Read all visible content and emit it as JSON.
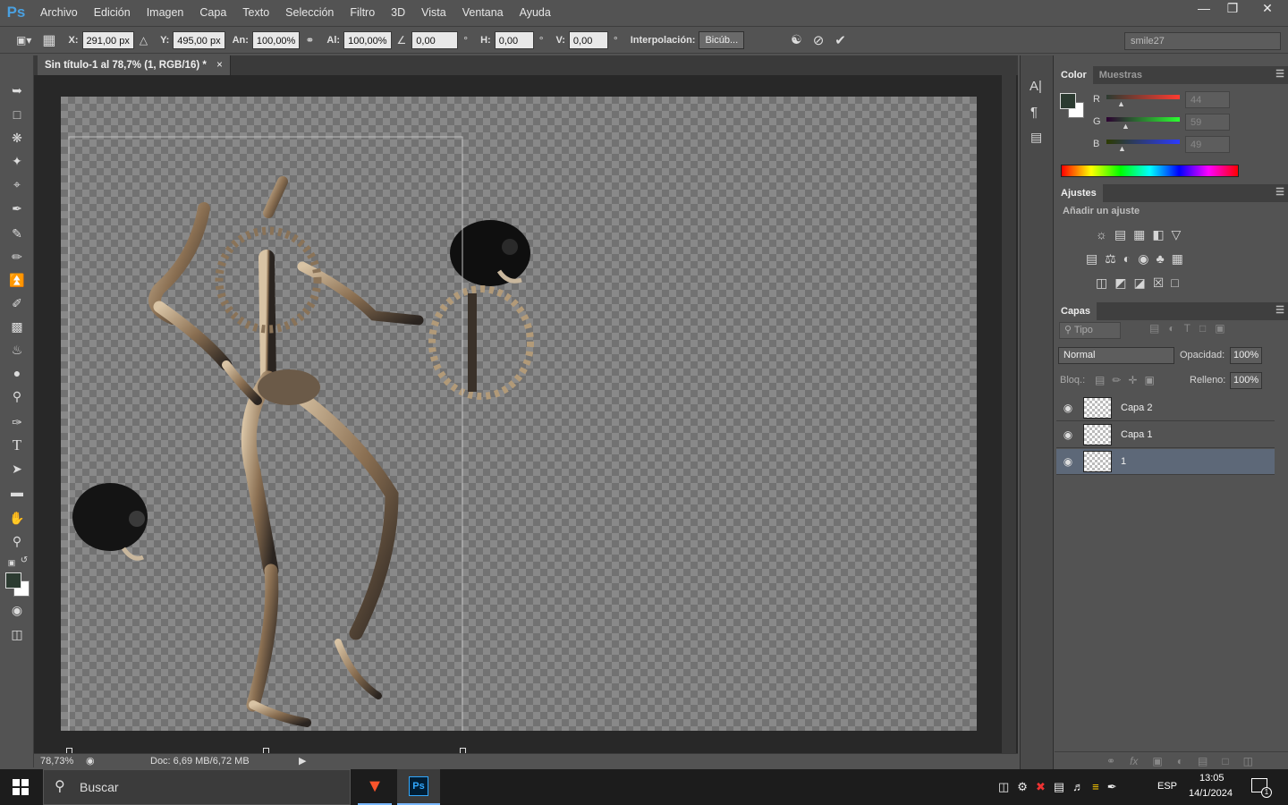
{
  "app": {
    "logo": "Ps"
  },
  "menu": [
    "Archivo",
    "Edición",
    "Imagen",
    "Capa",
    "Texto",
    "Selección",
    "Filtro",
    "3D",
    "Vista",
    "Ventana",
    "Ayuda"
  ],
  "window_controls": [
    "minimize-icon",
    "restore-icon",
    "close-icon"
  ],
  "options": {
    "x_label": "X:",
    "x_value": "291,00 px",
    "y_label": "Y:",
    "y_value": "495,00 px",
    "w_label": "An:",
    "w_value": "100,00%",
    "h_label": "Al:",
    "h_value": "100,00%",
    "angle_value": "0,00",
    "deg": "°",
    "hskew_label": "H:",
    "hskew_value": "0,00",
    "vskew_label": "V:",
    "vskew_value": "0,00",
    "interp_label": "Interpolación:",
    "interp_value": "Bicúb...",
    "workspace": "smile27"
  },
  "document": {
    "tab_title": "Sin título-1 al 78,7% (1, RGB/16) *",
    "tab_close": "×",
    "zoom": "78,73%",
    "doc_size": "Doc: 6,69 MB/6,72 MB"
  },
  "color_panel": {
    "tabs": [
      "Color",
      "Muestras"
    ],
    "channels": [
      {
        "label": "R",
        "value": "44",
        "fraction": 0.17
      },
      {
        "label": "G",
        "value": "59",
        "fraction": 0.23
      },
      {
        "label": "B",
        "value": "49",
        "fraction": 0.19
      }
    ],
    "foreground": "#2c3b31",
    "background": "#ffffff"
  },
  "adjustments": {
    "tab": "Ajustes",
    "subtitle": "Añadir un ajuste"
  },
  "layers_panel": {
    "tab": "Capas",
    "filter_label": "Tipo",
    "blend_mode": "Normal",
    "opacity_label": "Opacidad:",
    "opacity_value": "100%",
    "lock_label": "Bloq.:",
    "fill_label": "Relleno:",
    "fill_value": "100%",
    "layers": [
      {
        "name": "Capa 2",
        "selected": false
      },
      {
        "name": "Capa 1",
        "selected": false
      },
      {
        "name": "1",
        "selected": true
      }
    ]
  },
  "taskbar": {
    "search_placeholder": "Buscar",
    "language": "ESP",
    "time": "13:05",
    "date": "14/1/2024",
    "notification_count": "1"
  }
}
